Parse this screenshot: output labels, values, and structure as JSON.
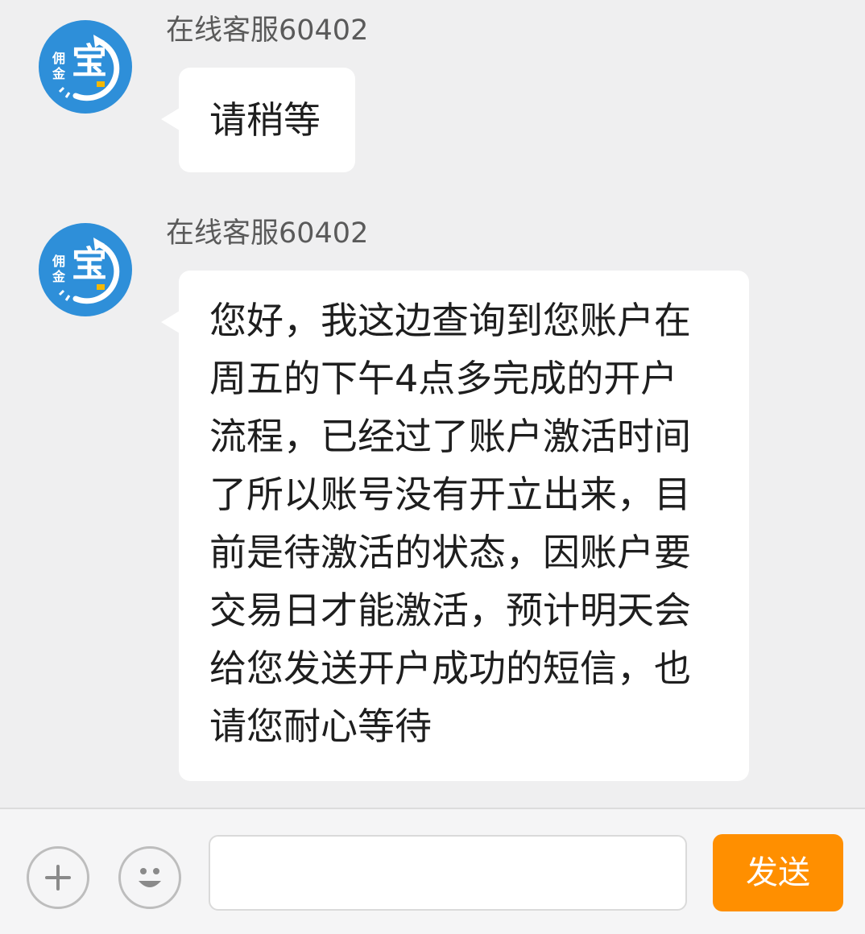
{
  "messages": [
    {
      "sender": "在线客服60402",
      "avatar_main": "宝",
      "avatar_side": "佣\n金",
      "text": "请稍等"
    },
    {
      "sender": "在线客服60402",
      "avatar_main": "宝",
      "avatar_side": "佣\n金",
      "text": "您好，我这边查询到您账户在\n周五的下午4点多完成的开户\n流程，已经过了账户激活时间\n了所以账号没有开立出来，目\n前是待激活的状态，因账户要\n交易日才能激活，预计明天会\n给您发送开户成功的短信，也\n请您耐心等待"
    }
  ],
  "input_bar": {
    "plus_icon": "plus-icon",
    "emoji_icon": "smiley-face-icon",
    "input_value": "",
    "input_placeholder": "",
    "send_label": "发送"
  },
  "colors": {
    "background": "#efeff0",
    "avatar_blue": "#2e8fd9",
    "send_orange": "#ff8f00",
    "bubble": "#ffffff"
  }
}
